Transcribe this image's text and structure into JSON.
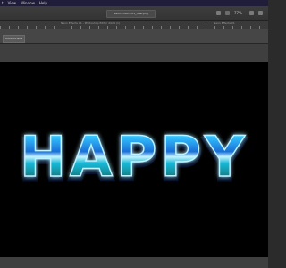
{
  "menubar": {
    "items": [
      "t",
      "View",
      "Window",
      "Help"
    ]
  },
  "toolbar": {
    "doc_title": "Neon-Effects-01_final.png",
    "zoom": "77%"
  },
  "ruler": {
    "left_label": "Neon Effects 01 - Photoshop Editor 2024 (1)",
    "right_label": "Neon Effects 01"
  },
  "canvas": {
    "tab_label": "Untitled-Now",
    "headline": "HAPPY"
  }
}
